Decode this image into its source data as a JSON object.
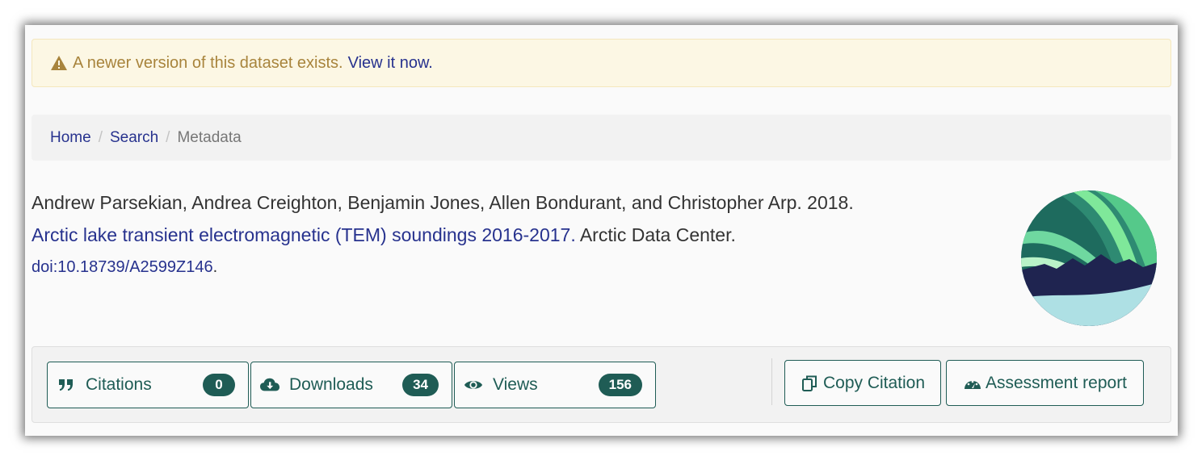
{
  "alert": {
    "message": "A newer version of this dataset exists.",
    "link_label": "View it now.",
    "icon": "warning-triangle-icon"
  },
  "breadcrumb": {
    "items": [
      "Home",
      "Search",
      "Metadata"
    ],
    "separator": "/"
  },
  "citation": {
    "authors_year": "Andrew Parsekian, Andrea Creighton, Benjamin Jones, Allen Bondurant, and Christopher Arp. 2018.",
    "title": "Arctic lake transient electromagnetic (TEM) soundings 2016-2017.",
    "publisher": " Arctic Data Center.",
    "doi": "doi:10.18739/A2599Z146",
    "doi_suffix": "."
  },
  "logo": {
    "icon": "arctic-data-center-aurora-logo"
  },
  "metrics": [
    {
      "label": "Citations",
      "count": "0",
      "icon": "quote-icon"
    },
    {
      "label": "Downloads",
      "count": "34",
      "icon": "cloud-download-icon"
    },
    {
      "label": "Views",
      "count": "156",
      "icon": "eye-icon"
    }
  ],
  "actions": {
    "copy_citation": "Copy Citation",
    "assessment_report": "Assessment report"
  },
  "colors": {
    "accent": "#1f5c55",
    "link": "#27328e",
    "alert_bg": "#fcf7e4",
    "alert_text": "#a8843c"
  }
}
